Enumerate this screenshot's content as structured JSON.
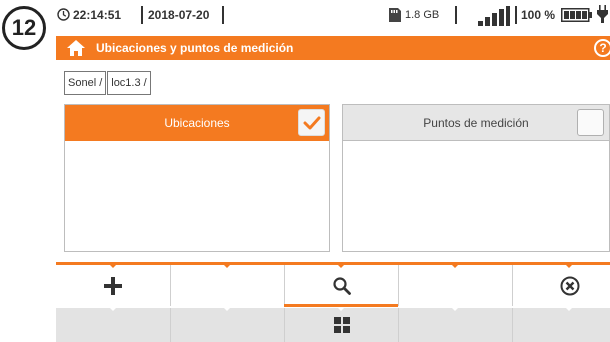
{
  "step_badge": "12",
  "status": {
    "time": "22:14:51",
    "date": "2018-07-20",
    "storage": "1.8 GB",
    "battery_percent": "100 %",
    "signal_level": 1.0,
    "icons": [
      "clock-icon",
      "sd-card-icon",
      "signal-icon",
      "battery-icon",
      "plug-icon"
    ]
  },
  "title_bar": {
    "title": "Ubicaciones y puntos de medición",
    "help": "?",
    "icons": [
      "home-icon",
      "help-icon"
    ]
  },
  "breadcrumb": [
    "Sonel /",
    "loc1.3 /"
  ],
  "panels": [
    {
      "label": "Ubicaciones",
      "checked": true,
      "active": true
    },
    {
      "label": "Puntos de medición",
      "checked": false,
      "active": false
    }
  ],
  "toolbar": {
    "row1_icons": [
      "plus-icon",
      "",
      "search-icon",
      "",
      "cancel-icon"
    ],
    "row2_icons": [
      "",
      "",
      "grid-icon",
      "",
      ""
    ],
    "selected_index": 2
  },
  "colors": {
    "accent": "#f47a20",
    "panel_header_inactive": "#e6e6e6",
    "toolbar_row2": "#e3e3e3"
  }
}
